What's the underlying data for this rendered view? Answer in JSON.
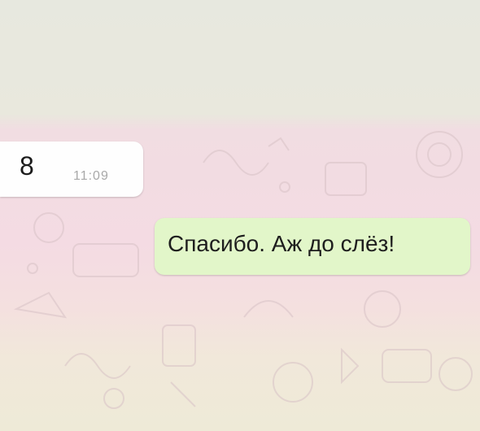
{
  "chat": {
    "messages": [
      {
        "direction": "incoming",
        "text": "8",
        "time": "11:09"
      },
      {
        "direction": "outgoing",
        "text": "Спасибо. Аж до слёз!"
      }
    ]
  },
  "colors": {
    "incoming_bubble": "#fefefe",
    "outgoing_bubble": "#e2f6c9",
    "chat_background": "#f4dbe3"
  }
}
